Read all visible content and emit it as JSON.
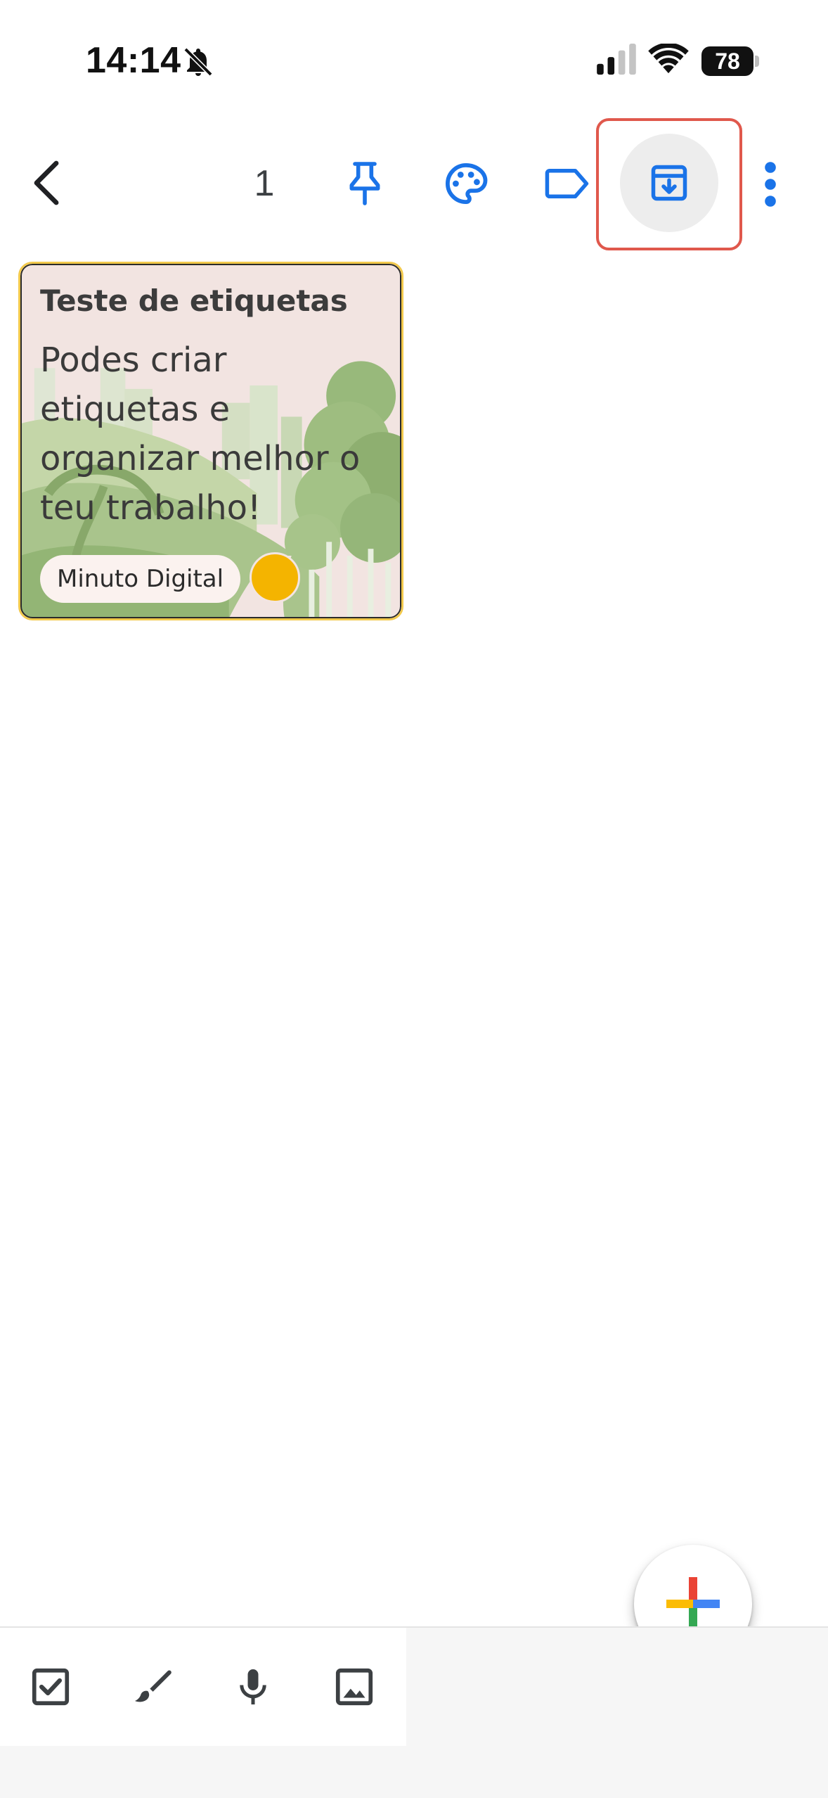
{
  "status_bar": {
    "time": "14:14",
    "battery": "78"
  },
  "toolbar": {
    "selected_count": "1",
    "icons": [
      "back-arrow-icon",
      "pin-icon",
      "palette-icon",
      "label-icon",
      "archive-icon",
      "more-vert-icon"
    ]
  },
  "note": {
    "title": "Teste de etiquetas",
    "body": "Podes criar etiquetas e organizar melhor o teu trabalho!",
    "label_chip": "Minuto Digital",
    "color_dot": "#f4b400"
  },
  "bottom_bar": {
    "icons": [
      "checkbox-icon",
      "brush-icon",
      "mic-icon",
      "image-icon"
    ]
  },
  "colors": {
    "accent_blue": "#1a73e8",
    "highlight_red": "#e0584c"
  }
}
